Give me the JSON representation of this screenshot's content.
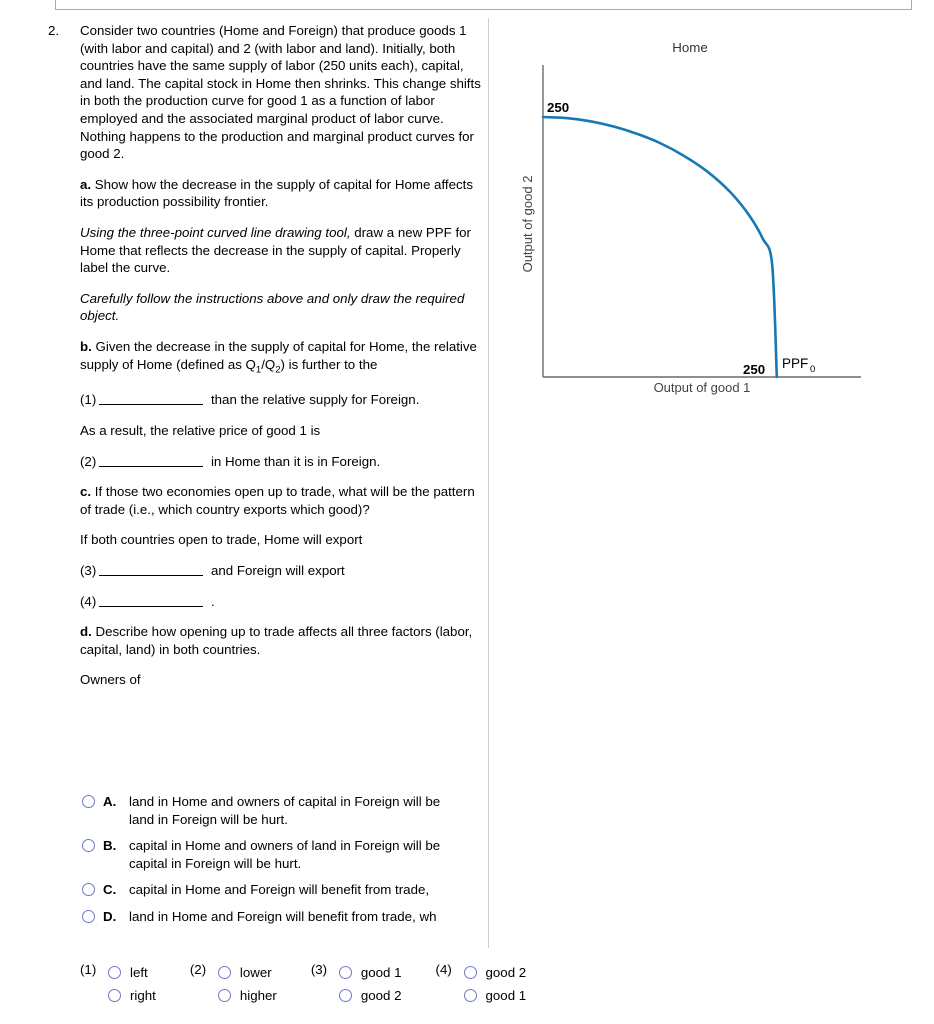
{
  "question": {
    "number": "2.",
    "stem": "Consider two countries (Home and Foreign) that produce goods 1 (with labor and capital) and 2 (with labor and land). Initially, both countries have the same supply of labor (250 units each), capital, and land. The capital stock in Home then shrinks. This change shifts in both the production curve for good 1 as a function of labor employed and the associated marginal product of labor curve. Nothing happens to the production and marginal product curves for good 2.",
    "part_a_label": "a.",
    "part_a_text": " Show how the decrease in the supply of capital for Home affects its production possibility frontier.",
    "instruction_1_italic": "Using the three-point curved line drawing tool,",
    "instruction_1_rest": " draw a new PPF for Home that reflects the decrease in the supply of capital. Properly label the curve.",
    "instruction_2_italic": "Carefully follow the instructions above and only draw the required object.",
    "part_b_label": "b.",
    "part_b_text_1": " Given the decrease in the supply of capital for Home, the relative supply of Home (defined as Q",
    "part_b_sub_1": "1",
    "part_b_text_2": "/Q",
    "part_b_sub_2": "2",
    "part_b_text_3": ") is further to the",
    "blank_1_num": "(1)",
    "blank_1_after": " than the relative supply for Foreign.",
    "result_text": "As a result, the relative price of good 1 is",
    "blank_2_num": "(2)",
    "blank_2_after": " in Home than it is in Foreign.",
    "part_c_label": "c.",
    "part_c_text": " If those two economies open up to trade, what will be the pattern of trade (i.e., which country exports which good)?",
    "part_c_lead": "If both countries open to trade, Home will export",
    "blank_3_num": "(3)",
    "blank_3_after": " and Foreign will export",
    "blank_4_num": "(4)",
    "blank_4_after": " .",
    "part_d_label": "d.",
    "part_d_text": " Describe how opening up to trade affects all three factors (labor, capital, land) in both countries.",
    "owners_lead": "Owners of"
  },
  "choices": [
    {
      "letter": "A.",
      "text": "land in Home and owners of capital in Foreign will be\nland in Foreign will be hurt."
    },
    {
      "letter": "B.",
      "text": "capital in Home and owners of land in Foreign will be\ncapital in Foreign will be hurt."
    },
    {
      "letter": "C.",
      "text": "capital in Home and Foreign will benefit from trade, \u0001"
    },
    {
      "letter": "D.",
      "text": "land in Home and Foreign will benefit from trade, wh"
    }
  ],
  "answer_bank": [
    {
      "num": "(1)",
      "options": [
        "left",
        "right"
      ]
    },
    {
      "num": "(2)",
      "options": [
        "lower",
        "higher"
      ]
    },
    {
      "num": "(3)",
      "options": [
        "good 1",
        "good 2"
      ]
    },
    {
      "num": "(4)",
      "options": [
        "good 2",
        "good 1"
      ]
    }
  ],
  "colors": {
    "curve": "#1878b4",
    "axis": "#6b6b6b",
    "radio_outline": "#6f7ac4",
    "divider": "#cfcfcf"
  },
  "chart_data": {
    "type": "line",
    "title": "Home",
    "xlabel": "Output of good 1",
    "ylabel": "Output of good 2",
    "grid": false,
    "legend": null,
    "xlim": [
      0,
      340
    ],
    "ylim": [
      0,
      300
    ],
    "x_tick_labels": [
      "250"
    ],
    "y_tick_labels": [
      "250"
    ],
    "x_intercept_label": "250",
    "y_intercept_label": "250",
    "series": [
      {
        "name": "PPF0",
        "label_text": "PPF",
        "label_sub": "0",
        "color": "#1878b4",
        "x": [
          0,
          25,
          50,
          75,
          100,
          125,
          150,
          175,
          200,
          220,
          235,
          245,
          250
        ],
        "y": [
          250,
          249,
          246,
          241,
          234,
          225,
          213,
          198,
          178,
          156,
          133,
          108,
          0
        ]
      }
    ]
  }
}
